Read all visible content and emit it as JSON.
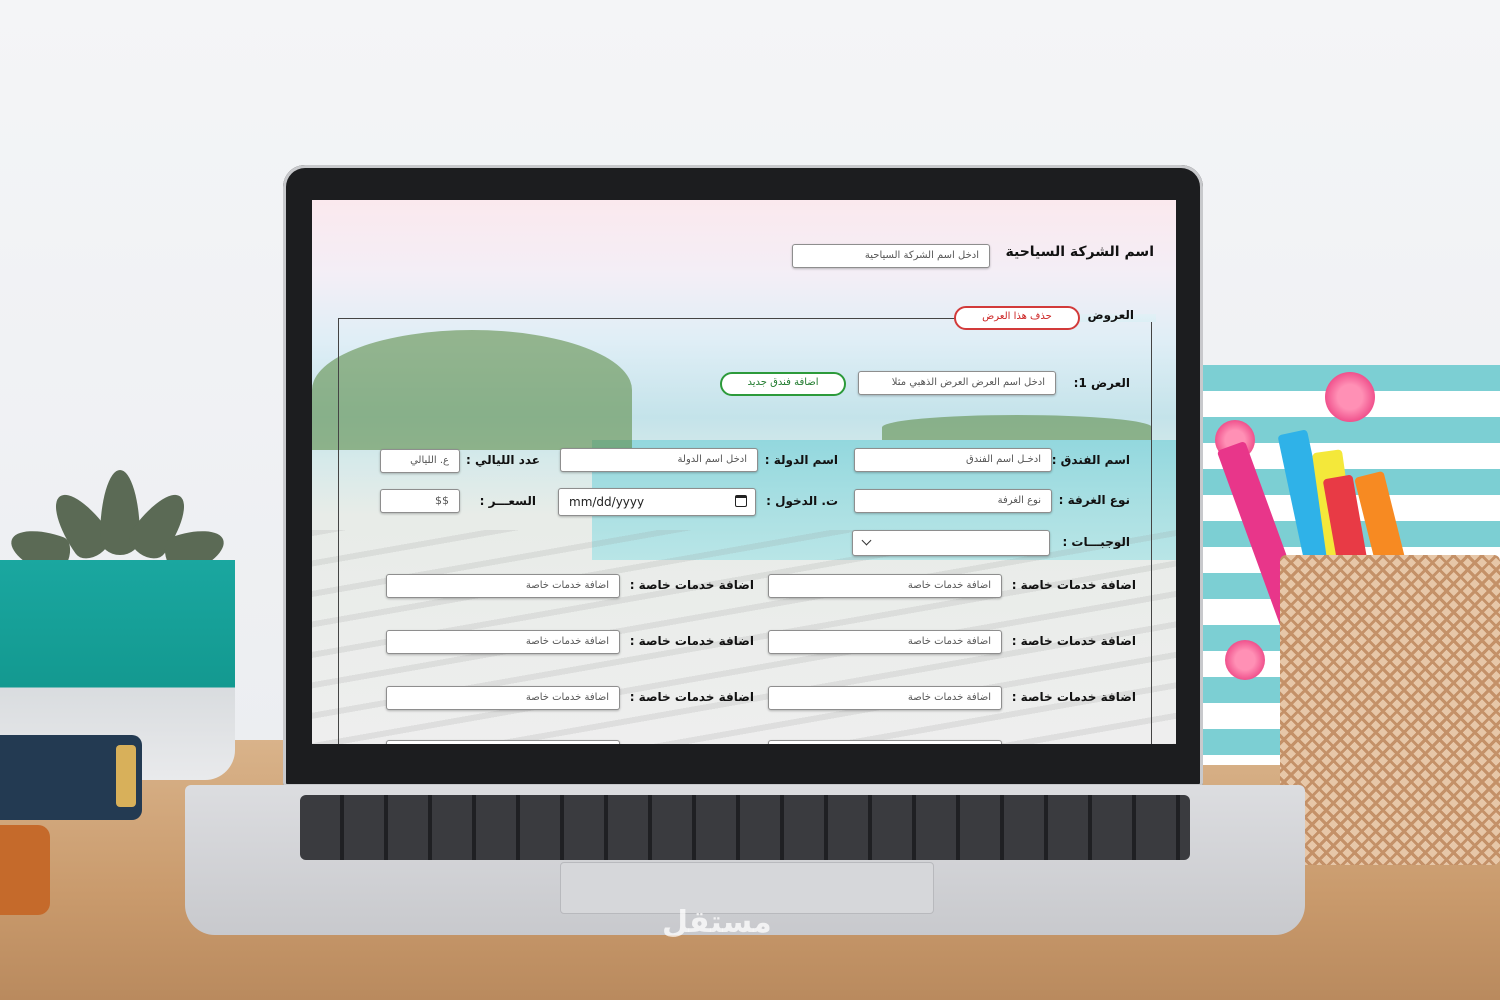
{
  "form": {
    "company_label": "اسم الشركة السياحية",
    "company_placeholder": "ادخل اسم الشركة السياحية",
    "offers_label": "العروض",
    "delete_offer_button": "حذف هذا العرض",
    "offer_label": "العرض 1:",
    "offer_placeholder": "ادخل اسم العرض العرض الذهبي مثلا",
    "add_hotel_button": "اضافة فندق جديد",
    "hotel_label": "اسم الفندق :",
    "hotel_placeholder": "ادخـل اسم الفندق",
    "country_label": "اسم الدولة :",
    "country_placeholder": "ادخل اسم الدولة",
    "nights_label": "عدد الليالي :",
    "nights_placeholder": "ع. الليالي",
    "room_label": "نوع الغرفة :",
    "room_placeholder": "نوع الغرفة",
    "checkin_label": "ت. الدخول :",
    "checkin_value": "mm/dd/yyyy",
    "price_label": "السعـــر :",
    "price_placeholder": "$$",
    "meals_label": "الوجبـــات :",
    "meals_value": "",
    "services_label": "اضافة خدمات خاصة :",
    "services_placeholder": "اضافة خدمات خاصة"
  },
  "icons": {
    "calendar": "calendar-icon",
    "chevron": "chevron-down-icon"
  },
  "colors": {
    "delete_border": "#d23a3a",
    "add_border": "#2c9a3a"
  },
  "watermark": "مستقل"
}
